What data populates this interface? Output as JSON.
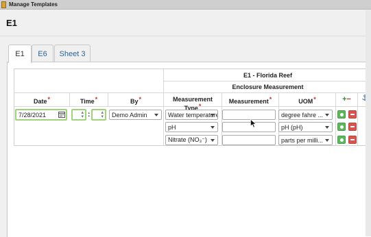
{
  "window": {
    "title": "Manage Templates"
  },
  "page": {
    "heading": "E1"
  },
  "tabs": [
    {
      "label": "E1",
      "active": true
    },
    {
      "label": "E6",
      "active": false
    },
    {
      "label": "Sheet 3",
      "active": false
    }
  ],
  "table": {
    "group_title": "E1 - Florida Reef",
    "subgroup_title": "Enclosure Measurement",
    "columns": {
      "date": "Date",
      "time": "Time",
      "by": "By",
      "measurement_type": "Measurement Type",
      "measurement": "Measurement",
      "uom": "UOM"
    },
    "add_remove_header": {
      "plus": "+",
      "minus": "−"
    },
    "info_icon": "anchor-icon",
    "entry": {
      "date": "7/28/2021",
      "time_hours": "",
      "time_minutes": "",
      "time_separator": ":",
      "by": "Demo Admin"
    },
    "rows": [
      {
        "measurement_type": "Water temperature",
        "measurement": "",
        "uom": "degree fahre ..."
      },
      {
        "measurement_type": "pH",
        "measurement": "",
        "uom": "pH (pH)"
      },
      {
        "measurement_type": "Nitrate (NO₃⁻)",
        "measurement": "",
        "uom": "parts per milli..."
      }
    ]
  },
  "colors": {
    "required": "#c0392b",
    "add": "#5cb85c",
    "remove": "#d9534f",
    "focus_border": "#9ed37a",
    "tab_link": "#2a6496"
  }
}
